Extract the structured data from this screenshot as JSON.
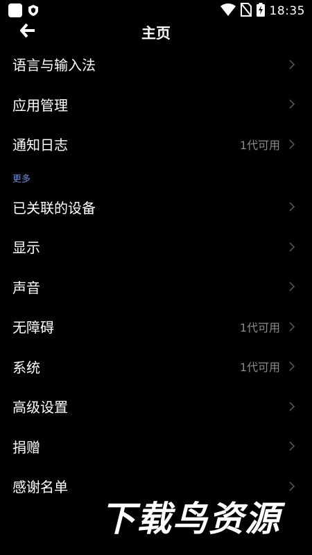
{
  "status_bar": {
    "time": "18:35",
    "icons": [
      "app-icon",
      "shield-icon",
      "wifi-icon",
      "no-sim-icon",
      "battery-charging-icon"
    ]
  },
  "toolbar": {
    "title": "主页",
    "back_icon": "arrow-left-icon"
  },
  "rows_top": [
    {
      "label": "语言与输入法",
      "value": ""
    },
    {
      "label": "应用管理",
      "value": ""
    },
    {
      "label": "通知日志",
      "value": "1代可用"
    }
  ],
  "section": {
    "title": "更多"
  },
  "rows_more": [
    {
      "label": "已关联的设备",
      "value": ""
    },
    {
      "label": "显示",
      "value": ""
    },
    {
      "label": "声音",
      "value": ""
    },
    {
      "label": "无障碍",
      "value": "1代可用"
    },
    {
      "label": "系统",
      "value": "1代可用"
    },
    {
      "label": "高级设置",
      "value": ""
    },
    {
      "label": "捐赠",
      "value": ""
    },
    {
      "label": "感谢名单",
      "value": ""
    }
  ],
  "watermark": {
    "text": "下载鸟资源"
  },
  "colors": {
    "background": "#000000",
    "text": "#ffffff",
    "secondary_text": "#8c8c8c",
    "section_accent": "#6f8fd6",
    "chevron": "#555555"
  }
}
